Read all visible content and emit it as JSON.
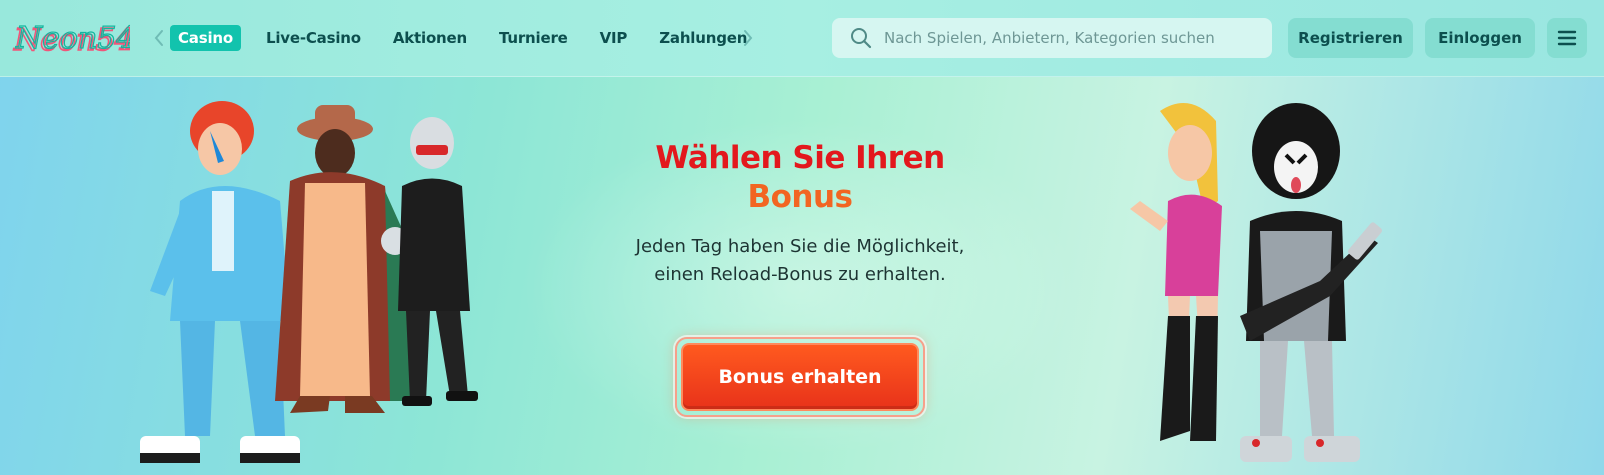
{
  "brand": {
    "logo_text": "Neon54"
  },
  "nav": {
    "items": [
      {
        "label": "Casino",
        "active": true
      },
      {
        "label": "Live-Casino",
        "active": false
      },
      {
        "label": "Aktionen",
        "active": false
      },
      {
        "label": "Turniere",
        "active": false
      },
      {
        "label": "VIP",
        "active": false
      },
      {
        "label": "Zahlungen",
        "active": false
      }
    ]
  },
  "search": {
    "placeholder": "Nach Spielen, Anbietern, Kategorien suchen",
    "value": ""
  },
  "header_buttons": {
    "register": "Registrieren",
    "login": "Einloggen"
  },
  "hero": {
    "title_line1": "Wählen Sie Ihren",
    "title_line2": "Bonus",
    "subtitle": "Jeden Tag haben Sie die Möglichkeit, einen Reload-Bonus zu erhalten.",
    "cta_label": "Bonus erhalten"
  },
  "colors": {
    "accent_teal": "#12c3ad",
    "title_red": "#e3181d",
    "title_orange": "#f26522",
    "cta_orange": "#ff5a1f",
    "nav_text": "#0c4f4e"
  },
  "icons": [
    "chevron-left-icon",
    "chevron-right-icon",
    "search-icon",
    "menu-icon"
  ]
}
